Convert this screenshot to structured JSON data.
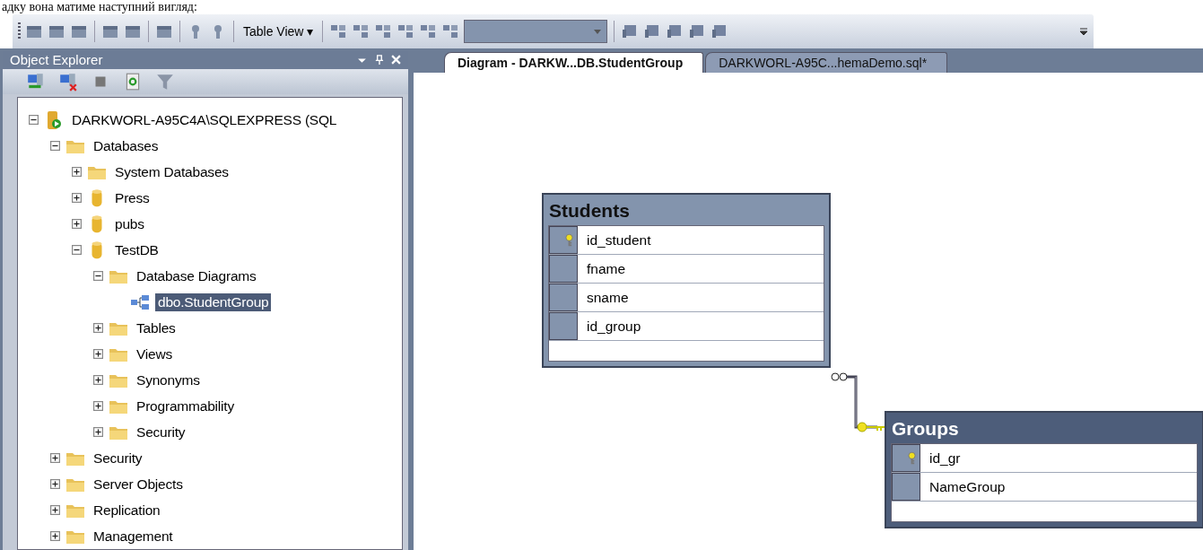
{
  "caption": "адку вона матиме наступний вигляд:",
  "toolbar": {
    "table_view": "Table View",
    "dropdown_arrow": "▾"
  },
  "object_explorer": {
    "title": "Object Explorer",
    "tree": [
      {
        "label": "DARKWORL-A95C4A\\SQLEXPRESS (SQL",
        "kind": "server",
        "expanded": true,
        "selected": false,
        "children": [
          {
            "label": "Databases",
            "kind": "folder",
            "expanded": true,
            "selected": false,
            "children": [
              {
                "label": "System Databases",
                "kind": "folder",
                "expanded": false,
                "selected": false
              },
              {
                "label": "Press",
                "kind": "database",
                "expanded": false,
                "selected": false
              },
              {
                "label": "pubs",
                "kind": "database",
                "expanded": false,
                "selected": false
              },
              {
                "label": "TestDB",
                "kind": "database",
                "expanded": true,
                "selected": false,
                "children": [
                  {
                    "label": "Database Diagrams",
                    "kind": "folder",
                    "expanded": true,
                    "selected": false,
                    "children": [
                      {
                        "label": "dbo.StudentGroup",
                        "kind": "diagram",
                        "selected": true
                      }
                    ]
                  },
                  {
                    "label": "Tables",
                    "kind": "folder",
                    "expanded": false,
                    "selected": false
                  },
                  {
                    "label": "Views",
                    "kind": "folder",
                    "expanded": false,
                    "selected": false
                  },
                  {
                    "label": "Synonyms",
                    "kind": "folder",
                    "expanded": false,
                    "selected": false
                  },
                  {
                    "label": "Programmability",
                    "kind": "folder",
                    "expanded": false,
                    "selected": false
                  },
                  {
                    "label": "Security",
                    "kind": "folder",
                    "expanded": false,
                    "selected": false
                  }
                ]
              }
            ]
          },
          {
            "label": "Security",
            "kind": "folder",
            "expanded": false,
            "selected": false
          },
          {
            "label": "Server Objects",
            "kind": "folder",
            "expanded": false,
            "selected": false
          },
          {
            "label": "Replication",
            "kind": "folder",
            "expanded": false,
            "selected": false
          },
          {
            "label": "Management",
            "kind": "folder",
            "expanded": false,
            "selected": false
          }
        ]
      }
    ]
  },
  "tabs": [
    {
      "label": "Diagram - DARKW...DB.StudentGroup",
      "selected": true
    },
    {
      "label": "DARKWORL-A95C...hemaDemo.sql*",
      "selected": false
    }
  ],
  "diagram": {
    "tables": [
      {
        "name": "Students",
        "selected": false,
        "columns": [
          {
            "name": "id_student",
            "primary_key": true
          },
          {
            "name": "fname",
            "primary_key": false
          },
          {
            "name": "sname",
            "primary_key": false
          },
          {
            "name": "id_group",
            "primary_key": false
          }
        ]
      },
      {
        "name": "Groups",
        "selected": true,
        "columns": [
          {
            "name": "id_gr",
            "primary_key": true
          },
          {
            "name": "NameGroup",
            "primary_key": false
          }
        ]
      }
    ]
  }
}
